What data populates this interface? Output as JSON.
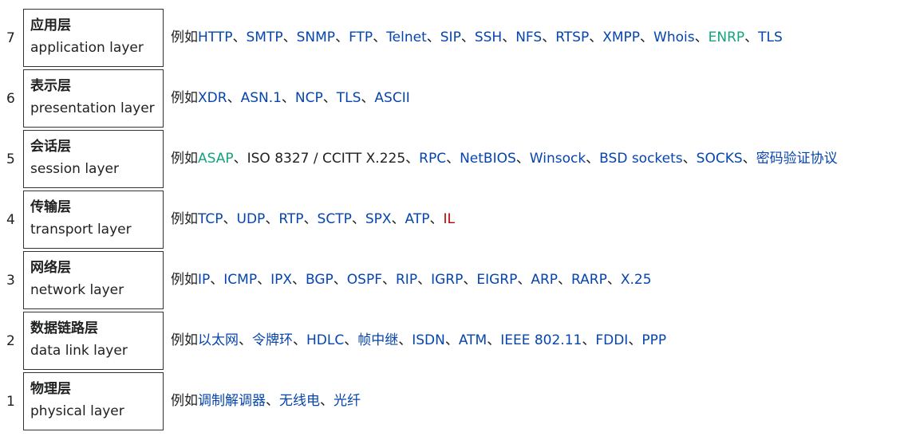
{
  "layers": [
    {
      "number": "7",
      "zh": "应用层",
      "en": "application layer",
      "parts": [
        {
          "text": "例如",
          "style": "plain"
        },
        {
          "text": "HTTP",
          "style": "link"
        },
        {
          "text": "、",
          "style": "plain"
        },
        {
          "text": "SMTP",
          "style": "link"
        },
        {
          "text": "、",
          "style": "plain"
        },
        {
          "text": "SNMP",
          "style": "link"
        },
        {
          "text": "、",
          "style": "plain"
        },
        {
          "text": "FTP",
          "style": "link"
        },
        {
          "text": "、",
          "style": "plain"
        },
        {
          "text": "Telnet",
          "style": "link"
        },
        {
          "text": "、",
          "style": "plain"
        },
        {
          "text": "SIP",
          "style": "link"
        },
        {
          "text": "、",
          "style": "plain"
        },
        {
          "text": "SSH",
          "style": "link"
        },
        {
          "text": "、",
          "style": "plain"
        },
        {
          "text": "NFS",
          "style": "link"
        },
        {
          "text": "、",
          "style": "plain"
        },
        {
          "text": "RTSP",
          "style": "link"
        },
        {
          "text": "、",
          "style": "plain"
        },
        {
          "text": "XMPP",
          "style": "link"
        },
        {
          "text": "、",
          "style": "plain"
        },
        {
          "text": "Whois",
          "style": "link"
        },
        {
          "text": "、",
          "style": "plain"
        },
        {
          "text": "ENRP",
          "style": "teal"
        },
        {
          "text": "、",
          "style": "plain"
        },
        {
          "text": "TLS",
          "style": "link"
        }
      ]
    },
    {
      "number": "6",
      "zh": "表示层",
      "en": "presentation layer",
      "parts": [
        {
          "text": "例如",
          "style": "plain"
        },
        {
          "text": "XDR",
          "style": "link"
        },
        {
          "text": "、",
          "style": "plain"
        },
        {
          "text": "ASN.1",
          "style": "link"
        },
        {
          "text": "、",
          "style": "plain"
        },
        {
          "text": "NCP",
          "style": "link"
        },
        {
          "text": "、",
          "style": "plain"
        },
        {
          "text": "TLS",
          "style": "link"
        },
        {
          "text": "、",
          "style": "plain"
        },
        {
          "text": "ASCII",
          "style": "link"
        }
      ]
    },
    {
      "number": "5",
      "zh": "会话层",
      "en": "session layer",
      "parts": [
        {
          "text": "例如",
          "style": "plain"
        },
        {
          "text": "ASAP",
          "style": "teal"
        },
        {
          "text": "、ISO 8327 / CCITT X.225、",
          "style": "plain"
        },
        {
          "text": "RPC",
          "style": "link"
        },
        {
          "text": "、",
          "style": "plain"
        },
        {
          "text": "NetBIOS",
          "style": "link"
        },
        {
          "text": "、",
          "style": "plain"
        },
        {
          "text": "Winsock",
          "style": "link"
        },
        {
          "text": "、",
          "style": "plain"
        },
        {
          "text": "BSD sockets",
          "style": "link"
        },
        {
          "text": "、",
          "style": "plain"
        },
        {
          "text": "SOCKS",
          "style": "link"
        },
        {
          "text": "、",
          "style": "plain"
        },
        {
          "text": "密码验证协议",
          "style": "link"
        }
      ]
    },
    {
      "number": "4",
      "zh": "传输层",
      "en": "transport layer",
      "parts": [
        {
          "text": "例如",
          "style": "plain"
        },
        {
          "text": "TCP",
          "style": "link"
        },
        {
          "text": "、",
          "style": "plain"
        },
        {
          "text": "UDP",
          "style": "link"
        },
        {
          "text": "、",
          "style": "plain"
        },
        {
          "text": "RTP",
          "style": "link"
        },
        {
          "text": "、",
          "style": "plain"
        },
        {
          "text": "SCTP",
          "style": "link"
        },
        {
          "text": "、",
          "style": "plain"
        },
        {
          "text": "SPX",
          "style": "link"
        },
        {
          "text": "、",
          "style": "plain"
        },
        {
          "text": "ATP",
          "style": "link"
        },
        {
          "text": "、",
          "style": "plain"
        },
        {
          "text": "IL",
          "style": "red"
        }
      ]
    },
    {
      "number": "3",
      "zh": "网络层",
      "en": "network layer",
      "parts": [
        {
          "text": "例如",
          "style": "plain"
        },
        {
          "text": "IP",
          "style": "link"
        },
        {
          "text": "、",
          "style": "plain"
        },
        {
          "text": "ICMP",
          "style": "link"
        },
        {
          "text": "、",
          "style": "plain"
        },
        {
          "text": "IPX",
          "style": "link"
        },
        {
          "text": "、",
          "style": "plain"
        },
        {
          "text": "BGP",
          "style": "link"
        },
        {
          "text": "、",
          "style": "plain"
        },
        {
          "text": "OSPF",
          "style": "link"
        },
        {
          "text": "、",
          "style": "plain"
        },
        {
          "text": "RIP",
          "style": "link"
        },
        {
          "text": "、",
          "style": "plain"
        },
        {
          "text": "IGRP",
          "style": "link"
        },
        {
          "text": "、",
          "style": "plain"
        },
        {
          "text": "EIGRP",
          "style": "link"
        },
        {
          "text": "、",
          "style": "plain"
        },
        {
          "text": "ARP",
          "style": "link"
        },
        {
          "text": "、",
          "style": "plain"
        },
        {
          "text": "RARP",
          "style": "link"
        },
        {
          "text": "、",
          "style": "plain"
        },
        {
          "text": "X.25",
          "style": "link"
        }
      ]
    },
    {
      "number": "2",
      "zh": "数据链路层",
      "en": "data link layer",
      "parts": [
        {
          "text": "例如",
          "style": "plain"
        },
        {
          "text": "以太网",
          "style": "link"
        },
        {
          "text": "、",
          "style": "plain"
        },
        {
          "text": "令牌环",
          "style": "link"
        },
        {
          "text": "、",
          "style": "plain"
        },
        {
          "text": "HDLC",
          "style": "link"
        },
        {
          "text": "、",
          "style": "plain"
        },
        {
          "text": "帧中继",
          "style": "link"
        },
        {
          "text": "、",
          "style": "plain"
        },
        {
          "text": "ISDN",
          "style": "link"
        },
        {
          "text": "、",
          "style": "plain"
        },
        {
          "text": "ATM",
          "style": "link"
        },
        {
          "text": "、",
          "style": "plain"
        },
        {
          "text": "IEEE 802.11",
          "style": "link"
        },
        {
          "text": "、",
          "style": "plain"
        },
        {
          "text": "FDDI",
          "style": "link"
        },
        {
          "text": "、",
          "style": "plain"
        },
        {
          "text": "PPP",
          "style": "link"
        }
      ]
    },
    {
      "number": "1",
      "zh": "物理层",
      "en": "physical layer",
      "parts": [
        {
          "text": "例如",
          "style": "plain"
        },
        {
          "text": "调制解调器",
          "style": "link"
        },
        {
          "text": "、",
          "style": "plain"
        },
        {
          "text": "无线电",
          "style": "link"
        },
        {
          "text": "、",
          "style": "plain"
        },
        {
          "text": "光纤",
          "style": "link"
        }
      ]
    }
  ],
  "colors": {
    "text": "#202122",
    "link": "#0645ad",
    "teal": "#14a37f",
    "red": "#ba0000",
    "border": "#333333"
  }
}
